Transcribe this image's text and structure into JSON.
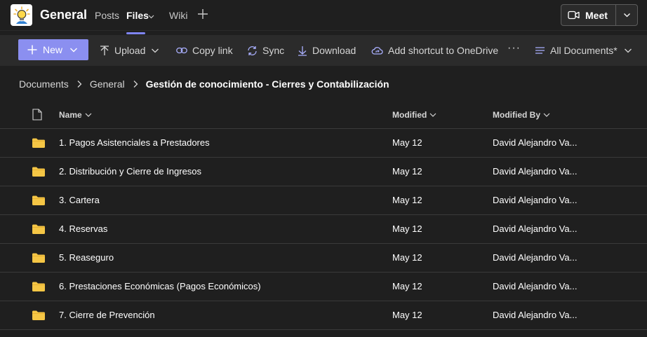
{
  "header": {
    "team_name": "General",
    "tabs": [
      {
        "label": "Posts"
      },
      {
        "label": "Files"
      },
      {
        "label": "Wiki"
      }
    ],
    "meet_label": "Meet"
  },
  "toolbar": {
    "new_label": "New",
    "upload_label": "Upload",
    "copy_link_label": "Copy link",
    "sync_label": "Sync",
    "download_label": "Download",
    "shortcut_label": "Add shortcut to OneDrive",
    "more_label": "···",
    "view_label": "All Documents*"
  },
  "breadcrumb": {
    "items": [
      "Documents",
      "General",
      "Gestión de conocimiento - Cierres y Contabilización"
    ]
  },
  "table": {
    "columns": {
      "name": "Name",
      "modified": "Modified",
      "modified_by": "Modified By"
    },
    "rows": [
      {
        "name": "1. Pagos Asistenciales a Prestadores",
        "modified": "May 12",
        "modified_by": "David Alejandro Va..."
      },
      {
        "name": "2. Distribución y Cierre de Ingresos",
        "modified": "May 12",
        "modified_by": "David Alejandro Va..."
      },
      {
        "name": "3. Cartera",
        "modified": "May 12",
        "modified_by": "David Alejandro Va..."
      },
      {
        "name": "4. Reservas",
        "modified": "May 12",
        "modified_by": "David Alejandro Va..."
      },
      {
        "name": "5. Reaseguro",
        "modified": "May 12",
        "modified_by": "David Alejandro Va..."
      },
      {
        "name": "6. Prestaciones Económicas (Pagos Económicos)",
        "modified": "May 12",
        "modified_by": "David Alejandro Va..."
      },
      {
        "name": "7. Cierre de Prevención",
        "modified": "May 12",
        "modified_by": "David Alejandro Va..."
      }
    ]
  },
  "colors": {
    "accent": "#8b8ff0",
    "tab_underline": "#7f85f5",
    "background": "#1f1f1f",
    "toolbar_background": "#2b2b2b",
    "folder": "#f5c645"
  },
  "icons": {
    "team_logo": "lightbulb-icon",
    "meet": "video-camera-icon",
    "new": "plus-icon",
    "upload": "arrow-up-icon",
    "copy_link": "link-icon",
    "sync": "sync-icon",
    "download": "arrow-down-icon",
    "shortcut": "cloud-shortcut-icon",
    "view": "list-icon",
    "doc_header": "document-icon",
    "row": "folder-icon"
  }
}
